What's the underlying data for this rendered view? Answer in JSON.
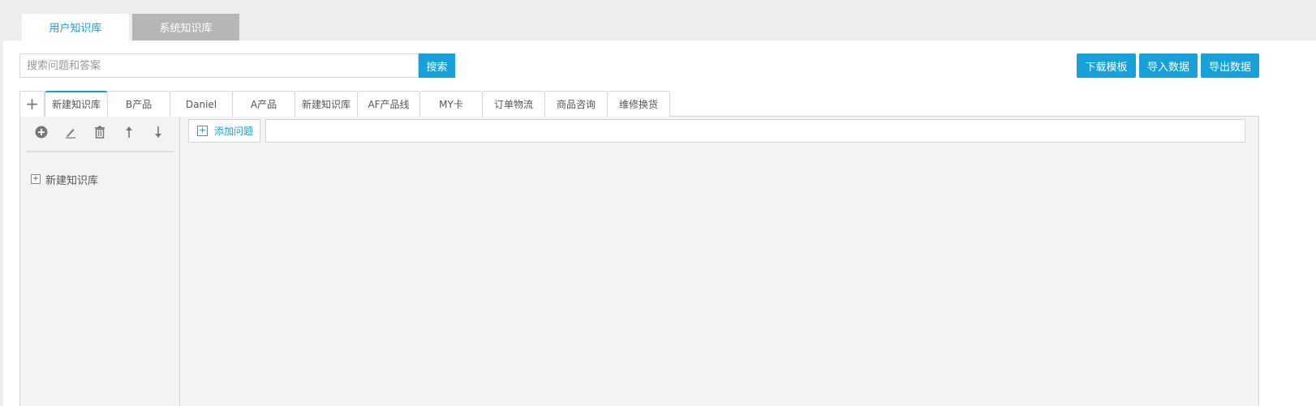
{
  "top_tabs": {
    "user_kb": "用户知识库",
    "system_kb": "系统知识库"
  },
  "search": {
    "placeholder": "搜索问题和答案",
    "button": "搜索"
  },
  "actions": {
    "download_template": "下载模板",
    "import_data": "导入数据",
    "export_data": "导出数据"
  },
  "kb_tabs": {
    "add_symbol": "+",
    "items": [
      "新建知识库",
      "B产品",
      "Daniel",
      "A产品",
      "新建知识库",
      "AF产品线",
      "MY卡",
      "订单物流",
      "商品咨询",
      "维修换货"
    ]
  },
  "sidebar": {
    "tools": [
      "add-circle-icon",
      "edit-pencil-icon",
      "trash-icon",
      "arrow-up-icon",
      "arrow-down-icon"
    ],
    "tree": [
      {
        "expand_symbol": "+",
        "label": "新建知识库"
      }
    ]
  },
  "content": {
    "add_question_label": "添加问题",
    "add_symbol": "+",
    "question_input_value": ""
  },
  "colors": {
    "accent": "#1aa0d8",
    "inactive_tab": "#b6b6b6",
    "panel_bg": "#f3f3f3",
    "page_bg": "#ededed"
  }
}
